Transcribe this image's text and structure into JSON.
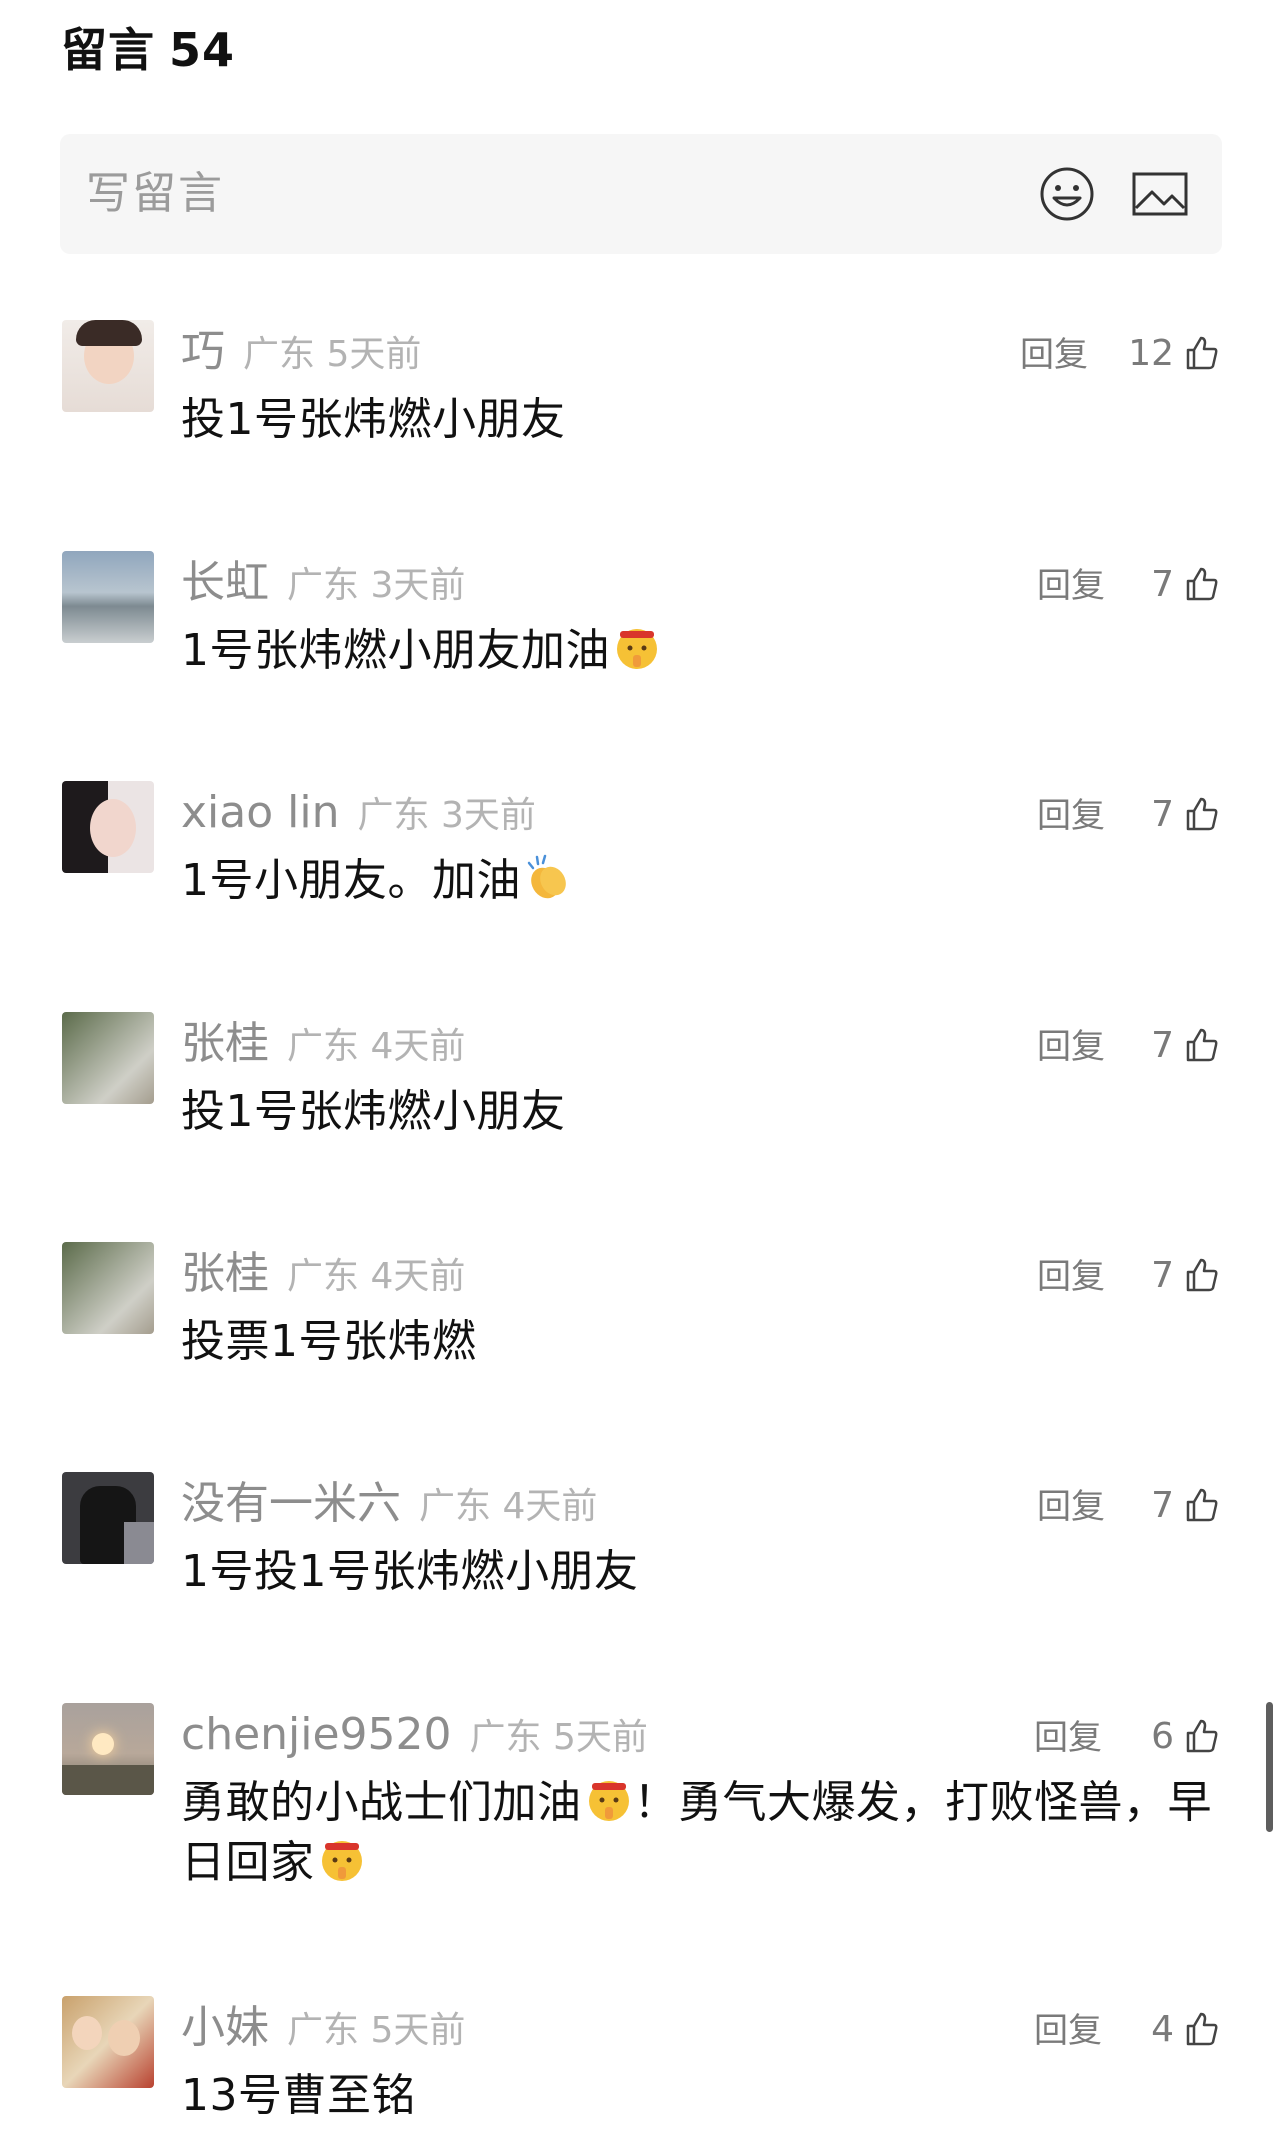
{
  "header": {
    "title": "留言",
    "count": "54"
  },
  "input": {
    "placeholder": "写留言",
    "emoji_icon": "smiley-face-icon",
    "image_icon": "image-icon"
  },
  "comments": [
    {
      "name": "巧",
      "region": "广东",
      "time": "5天前",
      "reply_label": "回复",
      "likes": "12",
      "text": "投1号张炜燃小朋友",
      "emoji": ""
    },
    {
      "name": "长虹",
      "region": "广东",
      "time": "3天前",
      "reply_label": "回复",
      "likes": "7",
      "text": "1号张炜燃小朋友加油",
      "emoji": "shushing-face-headband"
    },
    {
      "name": "xiao lin",
      "region": "广东",
      "time": "3天前",
      "reply_label": "回复",
      "likes": "7",
      "text": "1号小朋友。加油",
      "emoji": "clapping-hands"
    },
    {
      "name": "张桂",
      "region": "广东",
      "time": "4天前",
      "reply_label": "回复",
      "likes": "7",
      "text": "投1号张炜燃小朋友",
      "emoji": ""
    },
    {
      "name": "张桂",
      "region": "广东",
      "time": "4天前",
      "reply_label": "回复",
      "likes": "7",
      "text": "投票1号张炜燃",
      "emoji": ""
    },
    {
      "name": "没有一米六",
      "region": "广东",
      "time": "4天前",
      "reply_label": "回复",
      "likes": "7",
      "text": "1号投1号张炜燃小朋友",
      "emoji": ""
    },
    {
      "name": "chenjie9520",
      "region": "广东",
      "time": "5天前",
      "reply_label": "回复",
      "likes": "6",
      "text_part1": "勇敢的小战士们加油",
      "text_part2": "！勇气大爆发，打败怪兽，早日回家",
      "emoji": "shushing-face-headband"
    },
    {
      "name": "小妹",
      "region": "广东",
      "time": "5天前",
      "reply_label": "回复",
      "likes": "4",
      "text": "13号曹至铭",
      "emoji": ""
    }
  ],
  "colors": {
    "accent_text": "#111111",
    "muted": "#8d8d8d",
    "input_bg": "#f6f6f6"
  }
}
